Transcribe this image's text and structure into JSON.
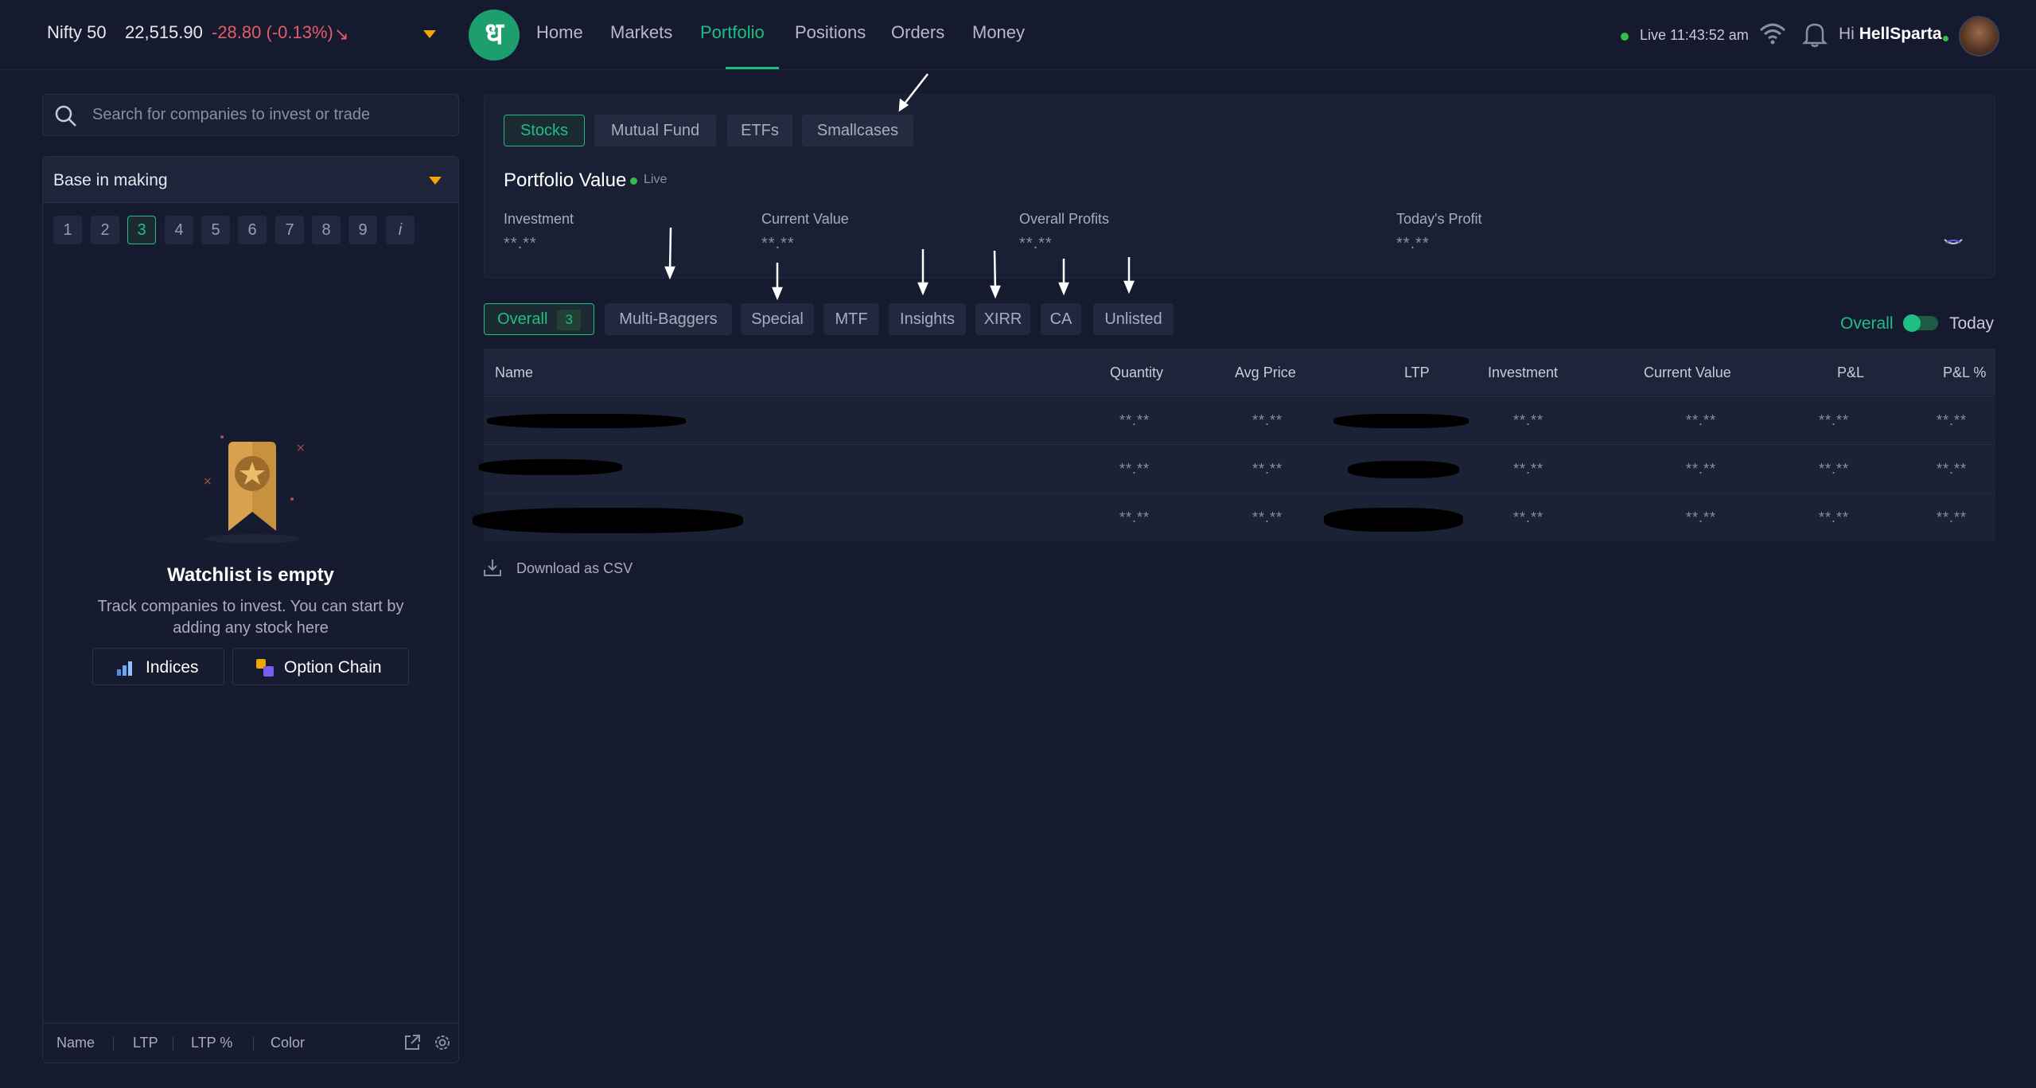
{
  "header": {
    "index_name": "Nifty 50",
    "index_value": "22,515.90",
    "index_change": "-28.80 (-0.13%)",
    "nav": [
      "Home",
      "Markets",
      "Portfolio",
      "Positions",
      "Orders",
      "Money"
    ],
    "active_nav": "Portfolio",
    "live_label": "Live 11:43:52 am",
    "greeting_prefix": "Hi",
    "username": "HellSparta"
  },
  "search": {
    "placeholder": "Search for companies to invest or trade"
  },
  "watchlist": {
    "name": "Base in making",
    "tabs": [
      "1",
      "2",
      "3",
      "4",
      "5",
      "6",
      "7",
      "8",
      "9",
      "i"
    ],
    "active_tab": "3",
    "empty_title": "Watchlist is empty",
    "empty_subtitle": "Track companies to invest. You can start by adding any stock here",
    "buttons": [
      "Indices",
      "Option Chain"
    ],
    "footer_columns": [
      "Name",
      "LTP",
      "LTP %",
      "Color"
    ]
  },
  "portfolio": {
    "segments": [
      "Stocks",
      "Mutual Fund",
      "ETFs",
      "Smallcases"
    ],
    "active_segment": "Stocks",
    "title": "Portfolio Value",
    "live_badge": "Live",
    "metrics": [
      {
        "label": "Investment",
        "value": "**.**"
      },
      {
        "label": "Current Value",
        "value": "**.**"
      },
      {
        "label": "Overall Profits",
        "value": "**.**"
      },
      {
        "label": "Today's Profit",
        "value": "**.**"
      }
    ]
  },
  "filters": {
    "tabs": [
      "Overall",
      "Multi-Baggers",
      "Special",
      "MTF",
      "Insights",
      "XIRR",
      "CA",
      "Unlisted"
    ],
    "overall_count": "3",
    "toggle_left": "Overall",
    "toggle_right": "Today"
  },
  "table": {
    "columns": [
      "Name",
      "Quantity",
      "Avg Price",
      "LTP",
      "Investment",
      "Current Value",
      "P&L",
      "P&L %"
    ],
    "rows": [
      [
        "",
        "**.**",
        "**.**",
        "",
        "**.**",
        "**.**",
        "**.**",
        "**.**"
      ],
      [
        "",
        "**.**",
        "**.**",
        "",
        "**.**",
        "**.**",
        "**.**",
        "**.**"
      ],
      [
        "",
        "**.**",
        "**.**",
        "",
        "**.**",
        "**.**",
        "**.**",
        "**.**"
      ]
    ]
  },
  "download_label": "Download as CSV",
  "colors": {
    "accent": "#1fbf83",
    "negative": "#e35d6a",
    "background": "#151a2e",
    "card": "#1a2034",
    "warning": "#f0a500"
  },
  "icons": [
    "search-icon",
    "wifi-icon",
    "bell-icon",
    "bookmark-star-icon",
    "indices-icon",
    "option-chain-icon",
    "external-link-icon",
    "gear-icon",
    "eye-closed-icon",
    "download-icon",
    "down-right-arrow-icon"
  ]
}
